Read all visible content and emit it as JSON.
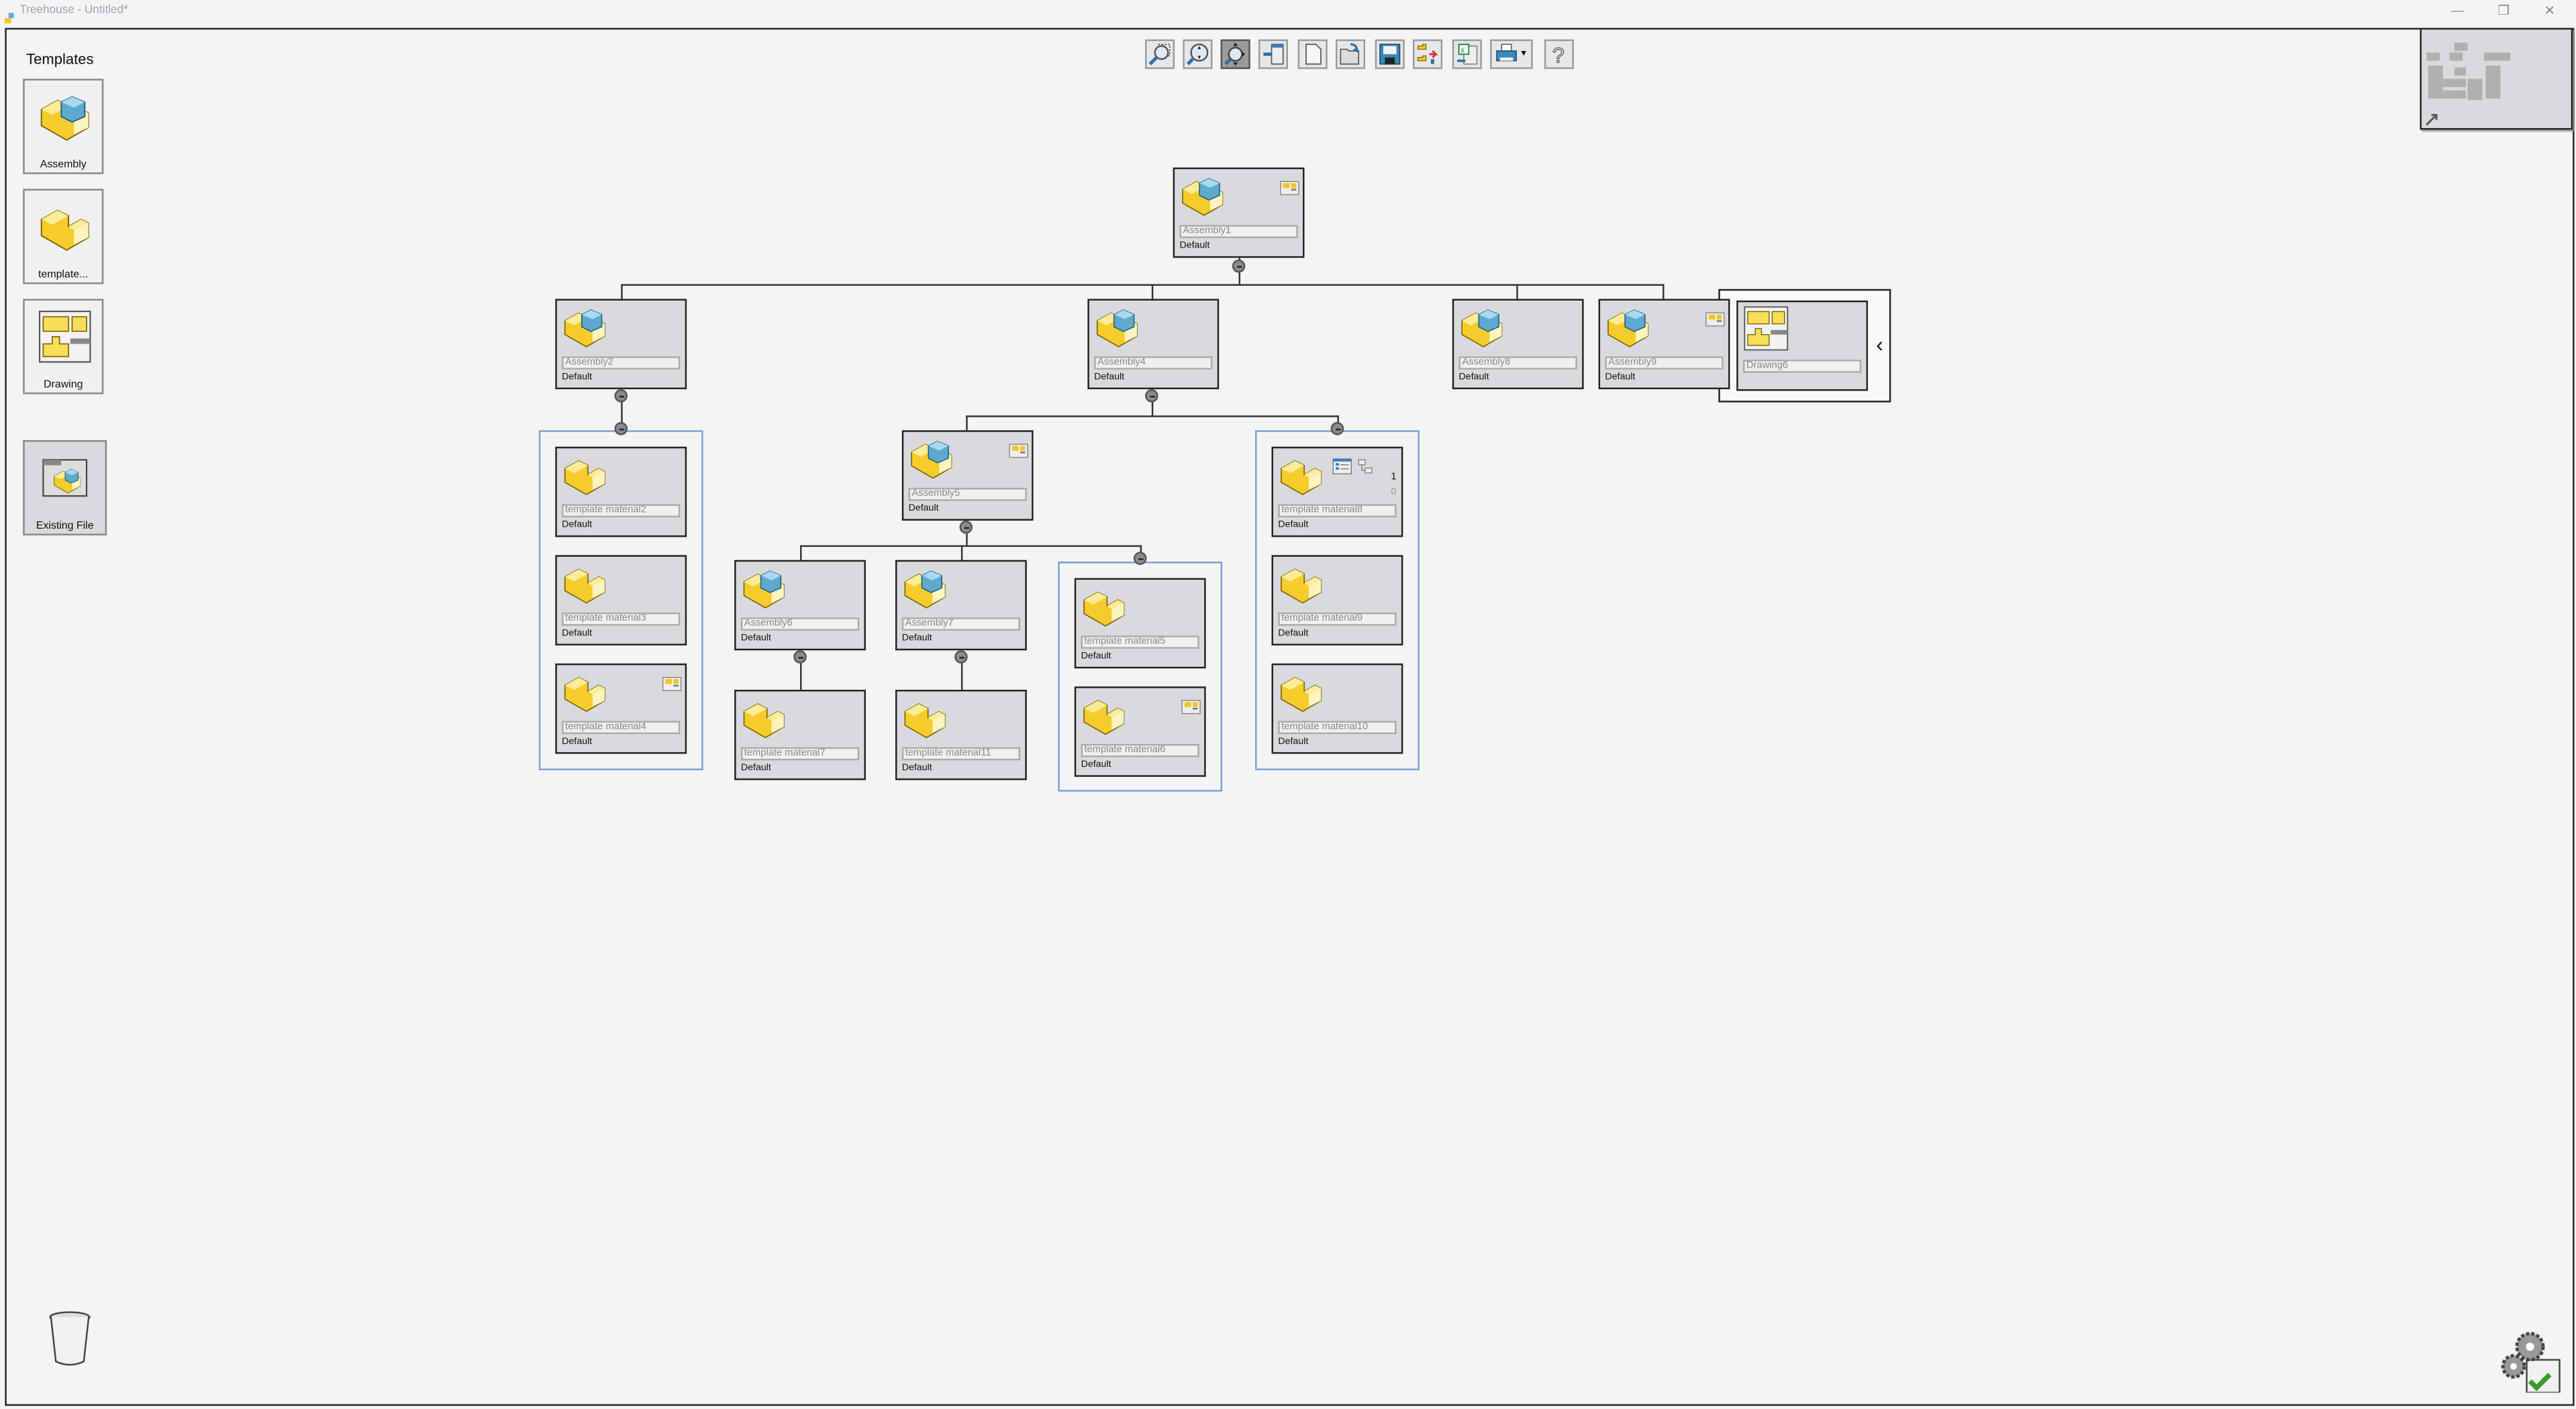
{
  "window": {
    "title": "Treehouse - Untitled*",
    "controls": [
      "minimize",
      "restore",
      "close"
    ]
  },
  "toolbar": {
    "buttons": [
      {
        "name": "zoom-to-area",
        "icon": "zoom-area-icon"
      },
      {
        "name": "zoom-to-fit",
        "icon": "zoom-fit-icon"
      },
      {
        "name": "pan-zoom",
        "icon": "pan-zoom-icon",
        "active": true
      },
      {
        "name": "import",
        "icon": "import-icon"
      },
      {
        "name": "new",
        "icon": "new-document-icon"
      },
      {
        "name": "open",
        "icon": "open-folder-icon"
      },
      {
        "name": "save",
        "icon": "save-icon"
      },
      {
        "name": "create-files",
        "icon": "create-files-icon"
      },
      {
        "name": "export-excel",
        "icon": "excel-export-icon"
      },
      {
        "name": "print",
        "icon": "print-icon",
        "dropdown": true
      },
      {
        "name": "help",
        "icon": "help-icon"
      }
    ]
  },
  "templates": {
    "heading": "Templates",
    "items": [
      {
        "label": "Assembly",
        "icon": "assembly-icon"
      },
      {
        "label": "template...",
        "icon": "part-icon"
      },
      {
        "label": "Drawing",
        "icon": "drawing-icon"
      },
      {
        "label": "Existing File",
        "icon": "existing-file-icon"
      }
    ]
  },
  "nodes": [
    {
      "label": "Assembly1",
      "config": "Default",
      "type": "assembly",
      "badge": true
    },
    {
      "label": "Assembly2",
      "config": "Default",
      "type": "assembly"
    },
    {
      "label": "Assembly4",
      "config": "Default",
      "type": "assembly"
    },
    {
      "label": "Assembly8",
      "config": "Default",
      "type": "assembly"
    },
    {
      "label": "Assembly9",
      "config": "Default",
      "type": "assembly",
      "badge": true
    },
    {
      "label": "Drawing6",
      "config": "",
      "type": "drawing"
    },
    {
      "label": "template material2",
      "config": "Default",
      "type": "part"
    },
    {
      "label": "template material3",
      "config": "Default",
      "type": "part"
    },
    {
      "label": "template material4",
      "config": "Default",
      "type": "part",
      "badge": true
    },
    {
      "label": "Assembly5",
      "config": "Default",
      "type": "assembly",
      "badge": true
    },
    {
      "label": "Assembly6",
      "config": "Default",
      "type": "assembly"
    },
    {
      "label": "Assembly7",
      "config": "Default",
      "type": "assembly"
    },
    {
      "label": "template material7",
      "config": "Default",
      "type": "part"
    },
    {
      "label": "template material11",
      "config": "Default",
      "type": "part"
    },
    {
      "label": "template material5",
      "config": "Default",
      "type": "part"
    },
    {
      "label": "template material6",
      "config": "Default",
      "type": "part",
      "badge": true
    },
    {
      "label": "template material8",
      "config": "Default",
      "type": "part",
      "extra": {
        "count": "1",
        "count2": "0"
      }
    },
    {
      "label": "template material9",
      "config": "Default",
      "type": "part"
    },
    {
      "label": "template material10",
      "config": "Default",
      "type": "part"
    }
  ],
  "colors": {
    "node_bg": "#d8dadd",
    "group_border": "#7d9fd0",
    "canvas": "#f4f4f4"
  },
  "footer": {
    "trash_icon": "trash-icon",
    "settings_icon": "settings-checklist-icon"
  }
}
